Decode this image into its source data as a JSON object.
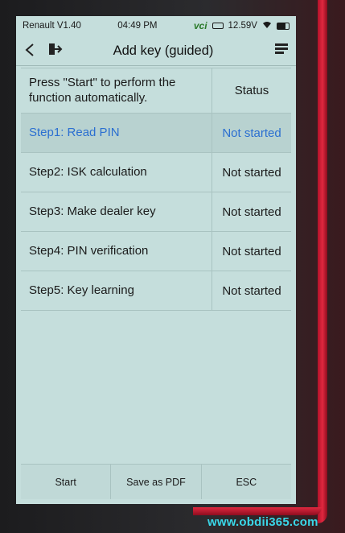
{
  "status_bar": {
    "app_version": "Renault V1.40",
    "time": "04:49 PM",
    "vci": "vci",
    "voltage": "12.59V"
  },
  "title_bar": {
    "title": "Add key (guided)"
  },
  "table": {
    "header": {
      "instruction": "Press \"Start\" to perform the function automatically.",
      "status_label": "Status"
    },
    "rows": [
      {
        "step": "Step1: Read PIN",
        "status": "Not started"
      },
      {
        "step": "Step2: ISK calculation",
        "status": "Not started"
      },
      {
        "step": "Step3: Make dealer key",
        "status": "Not started"
      },
      {
        "step": "Step4: PIN verification",
        "status": "Not started"
      },
      {
        "step": "Step5: Key learning",
        "status": "Not started"
      }
    ]
  },
  "bottom_bar": {
    "start": "Start",
    "save_pdf": "Save as PDF",
    "esc": "ESC"
  },
  "watermark": "www.obdii365.com",
  "colors": {
    "screen_bg": "#c5dedc",
    "active_text": "#2b6fd1",
    "device_red": "#e0283f"
  }
}
